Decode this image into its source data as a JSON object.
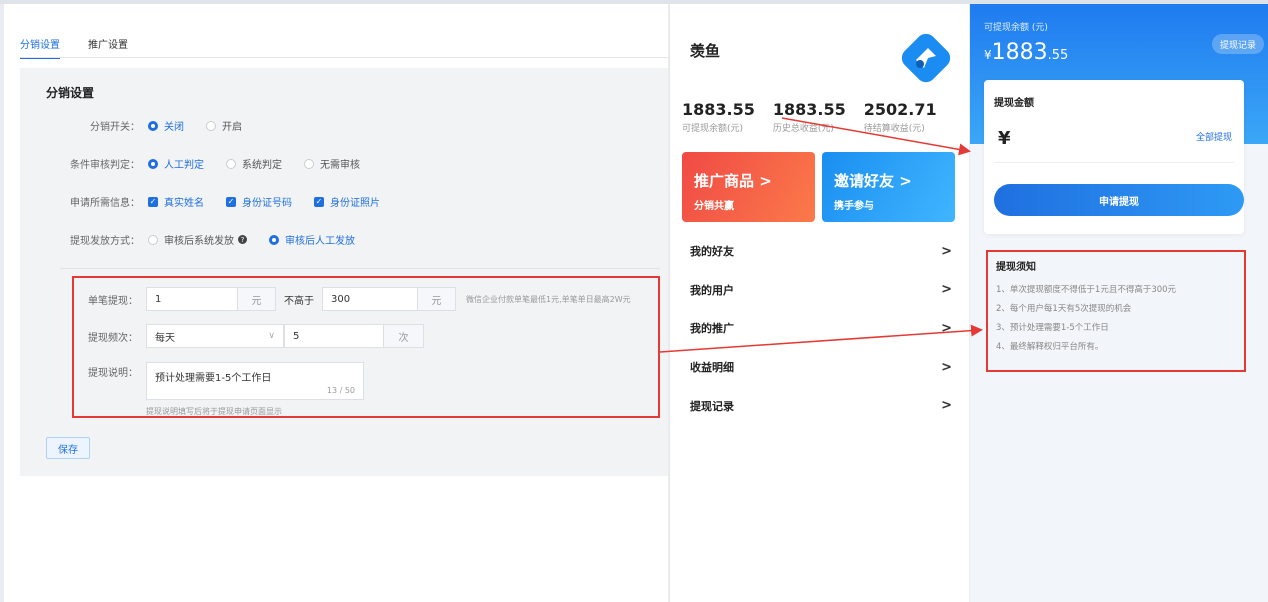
{
  "admin": {
    "tabs": [
      "分销设置",
      "推广设置"
    ],
    "card_title": "分销设置",
    "switch": {
      "label": "分销开关",
      "options": [
        "关闭",
        "开启"
      ],
      "selected": "关闭"
    },
    "audit": {
      "label": "条件审核判定",
      "options": [
        "人工判定",
        "系统判定",
        "无需审核"
      ],
      "selected": "人工判定"
    },
    "required_info": {
      "label": "申请所需信息",
      "options": [
        "真实姓名",
        "身份证号码",
        "身份证照片"
      ]
    },
    "payout": {
      "label": "提现发放方式",
      "options": [
        "审核后系统发放",
        "审核后人工发放"
      ],
      "selected": "审核后人工发放"
    },
    "single": {
      "label": "单笔提现",
      "min_value": "1",
      "min_unit": "元",
      "middle": "不高于",
      "max_value": "300",
      "max_unit": "元",
      "hint": "微信企业付款单笔最低1元,单笔单日最高2W元"
    },
    "frequency": {
      "label": "提现频次",
      "period": "每天",
      "count": "5",
      "unit": "次"
    },
    "desc": {
      "label": "提现说明",
      "value": "预计处理需要1-5个工作日",
      "counter": "13 / 50",
      "hint": "提现说明填写后将于提现申请页面显示"
    },
    "save_label": "保存"
  },
  "phone": {
    "brand": "羡鱼",
    "stats": [
      {
        "value": "1883.55",
        "label": "可提现余额(元)"
      },
      {
        "value": "1883.55",
        "label": "历史总收益(元)"
      },
      {
        "value": "2502.71",
        "label": "待结算收益(元)"
      }
    ],
    "promo_left": {
      "title": "推广商品 >",
      "sub": "分销共赢"
    },
    "promo_right": {
      "title": "邀请好友 >",
      "sub": "携手参与"
    },
    "menu": [
      "我的好友",
      "我的用户",
      "我的推广",
      "收益明细",
      "提现记录"
    ],
    "chevron": ">"
  },
  "withdraw": {
    "caption": "可提现余额 (元)",
    "currency": "¥",
    "amount_int": "1883",
    "amount_dec": ".55",
    "record_btn": "提现记录",
    "card_title": "提现金额",
    "yen": "¥",
    "all_label": "全部提现",
    "apply_label": "申请提现",
    "notice_title": "提现须知",
    "notice_items": [
      "1、单次提现额度不得低于1元且不得高于300元",
      "2、每个用户每1天有5次提现的机会",
      "3、预计处理需要1-5个工作日",
      "4、最终解释权归平台所有。"
    ]
  },
  "colors": {
    "accent": "#1f6fe0",
    "highlight": "#e53935"
  }
}
